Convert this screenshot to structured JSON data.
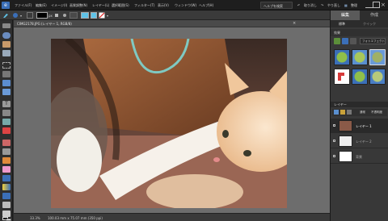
{
  "app": {
    "logo": "e"
  },
  "menu": {
    "items": [
      "ファイル(F)",
      "編集(E)",
      "イメージ(I)",
      "画質調整(N)",
      "レイヤー(L)",
      "選択範囲(S)",
      "フィルター(T)",
      "表示(V)",
      "ウィンドウ(W)",
      "ヘルプ(H)"
    ],
    "help_search": "ヘルプを検索",
    "undo": "取り消し",
    "redo": "やり直し",
    "organizer": "整理"
  },
  "options": {
    "unit": "px"
  },
  "document": {
    "tab_title": "CIMG2178.JPG (レイヤー 1, RGB/8)",
    "close_glyph": "×",
    "zoom": "33.3%",
    "info": "100.03 mm x 75.07 mm (350 ppi)"
  },
  "panel": {
    "tabs": [
      "編集",
      "作成"
    ],
    "subtabs": [
      "標準",
      "クイック"
    ],
    "effects_header": "効果",
    "filter_select": "フォトエフェクト",
    "layers_header": "レイヤー",
    "blend_mode": "通常",
    "opacity_label": "不透明度",
    "layers": [
      {
        "name": "レイヤー 1",
        "selected": true
      },
      {
        "name": "レイヤー 2",
        "selected": false
      },
      {
        "name": "背景",
        "selected": false
      }
    ]
  },
  "colors": {
    "accent_blue": "#3b6fb8",
    "active_tab": "#5a5a5a",
    "selected_layer": "#2a2a2a",
    "cyan_swatch": "#5fc3e8"
  },
  "icons": [
    "move-tool-icon",
    "zoom-tool-icon",
    "hand-tool-icon",
    "eyedropper-tool-icon",
    "marquee-tool-icon",
    "lasso-tool-icon",
    "magic-wand-tool-icon",
    "type-tool-icon",
    "crop-tool-icon",
    "brush-tool-icon",
    "eraser-tool-icon",
    "paint-bucket-tool-icon",
    "gradient-tool-icon",
    "shape-tool-icon",
    "foreground-color-icon",
    "background-color-icon"
  ]
}
